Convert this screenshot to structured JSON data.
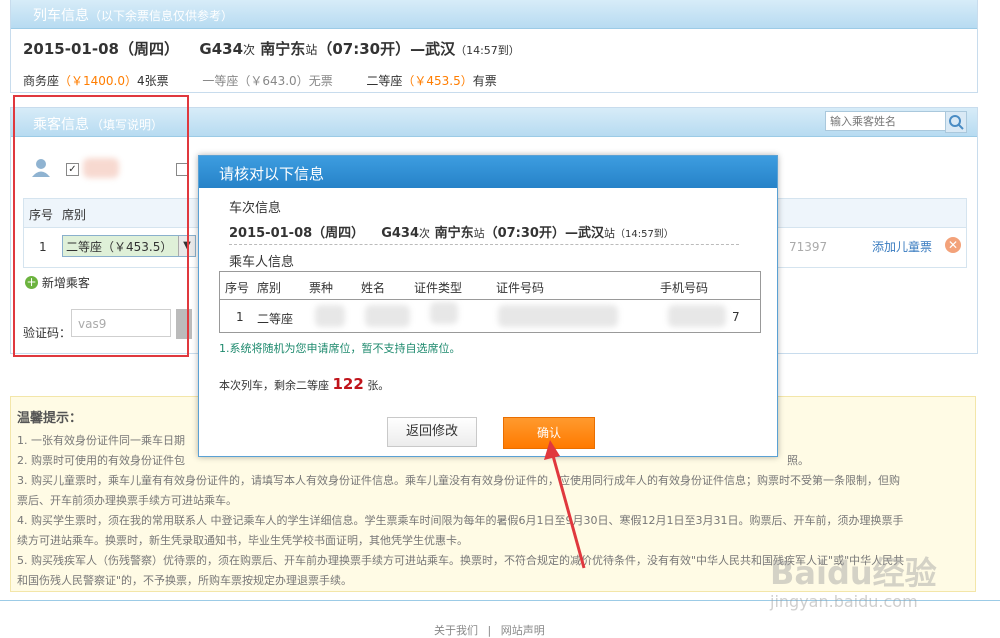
{
  "train_panel": {
    "title": "列车信息",
    "subtitle": "（以下余票信息仅供参考）",
    "date": "2015-01-08（周四）",
    "train_no": "G434",
    "train_suffix": "次",
    "from_station": "南宁东",
    "station_suffix": "站",
    "depart_time": "（07:30开）",
    "dash": "—",
    "to_station": "武汉",
    "arrive_time": "（14:57到）",
    "seats": [
      {
        "name": "商务座",
        "price": "（￥1400.0）",
        "avail": "4张票"
      },
      {
        "name": "一等座",
        "price": "（￥643.0）",
        "avail": "无票"
      },
      {
        "name": "二等座",
        "price": "（￥453.5）",
        "avail": "有票"
      }
    ]
  },
  "passenger_panel": {
    "title": "乘客信息",
    "subtitle": "（填写说明）",
    "search_placeholder": "输入乘客姓名",
    "col_no": "序号",
    "col_seat": "席别",
    "row_no": "1",
    "row_seat": "二等座（￥453.5）",
    "row_id_tail": "71397",
    "add_child": "添加儿童票",
    "add_passenger": "新增乘客",
    "captcha_label": "验证码：",
    "captcha_value": "vas9"
  },
  "notice": {
    "title": "温馨提示：",
    "lines": [
      "1. 一张有效身份证件同一乘车日期",
      "2. 购票时可使用的有效身份证件包",
      "照。",
      "3. 购买儿童票时，乘车儿童有有效身份证件的，请填写本人有效身份证件信息。乘车儿童没有有效身份证件的，应使用同行成年人的有效身份证件信息；购票时不受第一条限制，但购",
      "票后、开车前须办理换票手续方可进站乘车。",
      "4. 购买学生票时，须在我的常用联系人 中登记乘车人的学生详细信息。学生票乘车时间限为每年的暑假6月1日至9月30日、寒假12月1日至3月31日。购票后、开车前，须办理换票手",
      "续方可进站乘车。换票时，新生凭录取通知书，毕业生凭学校书面证明，其他凭学生优惠卡。",
      "5. 购买残疾军人（伤残警察）优待票的，须在购票后、开车前办理换票手续方可进站乘车。换票时，不符合规定的减价优待条件，没有有效\"中华人民共和国残疾军人证\"或\"中华人民共",
      "和国伤残人民警察证\"的，不予换票，所购车票按规定办理退票手续。"
    ]
  },
  "footer": {
    "about": "关于我们",
    "sep": "|",
    "site": "网站声明"
  },
  "dialog": {
    "title": "请核对以下信息",
    "train_section": "车次信息",
    "date": "2015-01-08（周四）",
    "train_no": "G434",
    "train_suffix": "次",
    "from_station": "南宁东",
    "station_suffix": "站",
    "depart_time": "（07:30开）",
    "dash": "—",
    "to_station": "武汉",
    "arrive_time": "（14:57到）",
    "passenger_section": "乘车人信息",
    "headers": [
      "序号",
      "席别",
      "票种",
      "姓名",
      "证件类型",
      "证件号码",
      "手机号码"
    ],
    "row_no": "1",
    "row_seat": "二等座",
    "row_phone_tail": "7",
    "note": "1.系统将随机为您申请席位，暂不支持自选席位。",
    "remain_prefix": "本次列车，剩余二等座",
    "remain_count": "122",
    "remain_suffix": "张。",
    "back_button": "返回修改",
    "confirm_button": "确认"
  },
  "watermark": {
    "brand": "Baidu经验",
    "url": "jingyan.baidu.com"
  },
  "colors": {
    "accent_orange": "#ff7f00",
    "dialog_header": "#2a8ed6",
    "annotation_red": "#e0383e",
    "panel_blue": "#b7dbf1"
  }
}
